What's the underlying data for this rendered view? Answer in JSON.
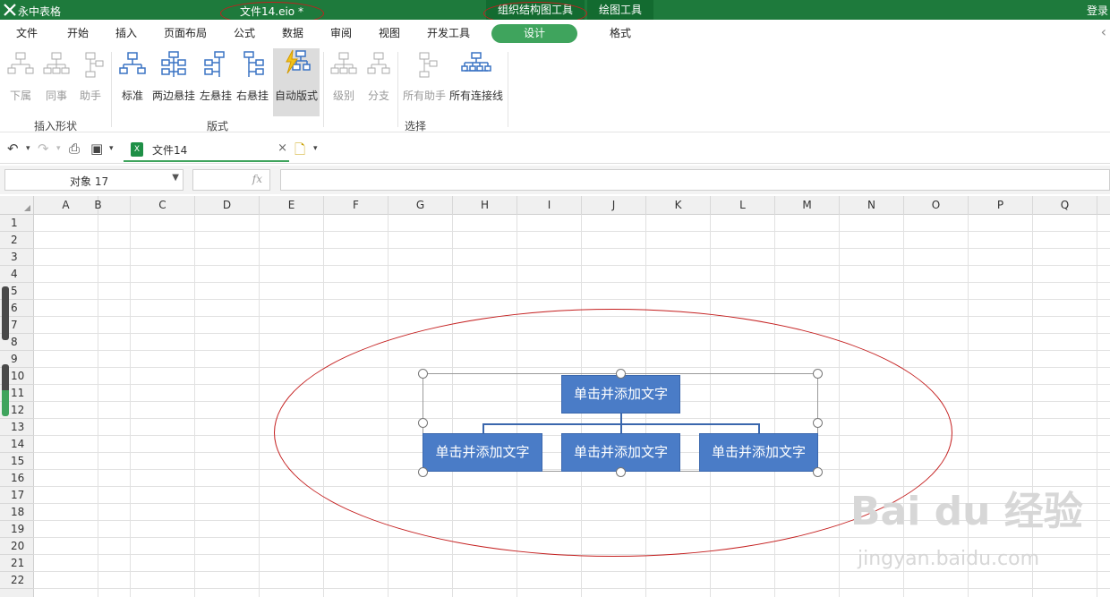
{
  "titlebar": {
    "app_name": "永中表格",
    "doc_title": "文件14.eio *",
    "context_tabs": [
      "组织结构图工具",
      "绘图工具"
    ],
    "login": "登录"
  },
  "menu": {
    "tabs": [
      "文件",
      "开始",
      "插入",
      "页面布局",
      "公式",
      "数据",
      "审阅",
      "视图",
      "开发工具",
      "设计",
      "格式"
    ],
    "active": "设计"
  },
  "ribbon": {
    "insert_shape": {
      "label": "插入形状",
      "buttons": [
        "下属",
        "同事",
        "助手"
      ]
    },
    "layout": {
      "label": "版式",
      "buttons": [
        "标准",
        "两边悬挂",
        "左悬挂",
        "右悬挂",
        "自动版式"
      ]
    },
    "select": {
      "label": "选择",
      "buttons": [
        "级别",
        "分支",
        "所有助手",
        "所有连接线"
      ]
    }
  },
  "quickaccess": {
    "file_tab": "文件14",
    "file_icon": "X"
  },
  "formulabar": {
    "namebox": "对象 17",
    "fx": "fx",
    "formula": ""
  },
  "sheet": {
    "columns": [
      "A",
      "B",
      "C",
      "D",
      "E",
      "F",
      "G",
      "H",
      "I",
      "J",
      "K",
      "L",
      "M",
      "N",
      "O",
      "P",
      "Q"
    ],
    "rows": [
      "1",
      "2",
      "3",
      "4",
      "5",
      "6",
      "7",
      "8",
      "9",
      "10",
      "11",
      "12",
      "13",
      "14",
      "15",
      "16",
      "17",
      "18",
      "19",
      "20",
      "21",
      "22"
    ]
  },
  "orgchart": {
    "top": "单击并添加文字",
    "children": [
      "单击并添加文字",
      "单击并添加文字",
      "单击并添加文字"
    ]
  },
  "watermark": {
    "brand": "Bai du 经验",
    "url": "jingyan.baidu.com"
  },
  "colors": {
    "titlebar": "#1e7a3c",
    "design_tab": "#3fa45d",
    "org_box": "#4a7cc7",
    "annotation": "#c41e1e"
  }
}
